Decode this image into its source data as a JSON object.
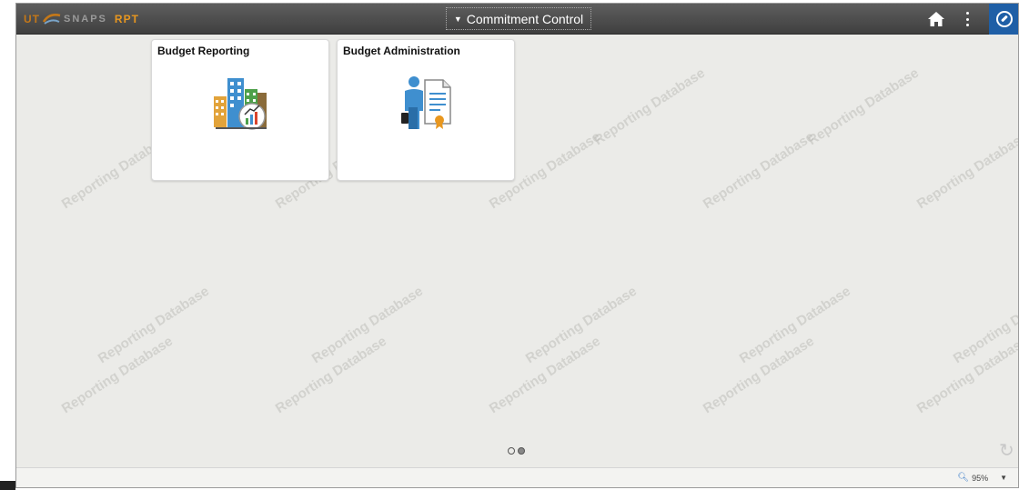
{
  "header": {
    "logo": {
      "ut": "UT",
      "snaps": "SNAPS",
      "rpt": "RPT"
    },
    "title": "Commitment Control",
    "home_icon": "home-icon",
    "more_icon": "more-vertical-icon",
    "navbar_icon": "compass-icon"
  },
  "watermark": "Reporting Database",
  "tiles": [
    {
      "title": "Budget Reporting",
      "icon": "buildings-chart-icon"
    },
    {
      "title": "Budget Administration",
      "icon": "person-certificate-icon"
    }
  ],
  "pager": {
    "pages": 2,
    "current": 2
  },
  "status": {
    "zoom": "95%"
  },
  "colors": {
    "topbar": "#4a4a4a",
    "navbar": "#1f5fa6",
    "background": "#ebebe8",
    "logo_accent": "#e8971f"
  }
}
